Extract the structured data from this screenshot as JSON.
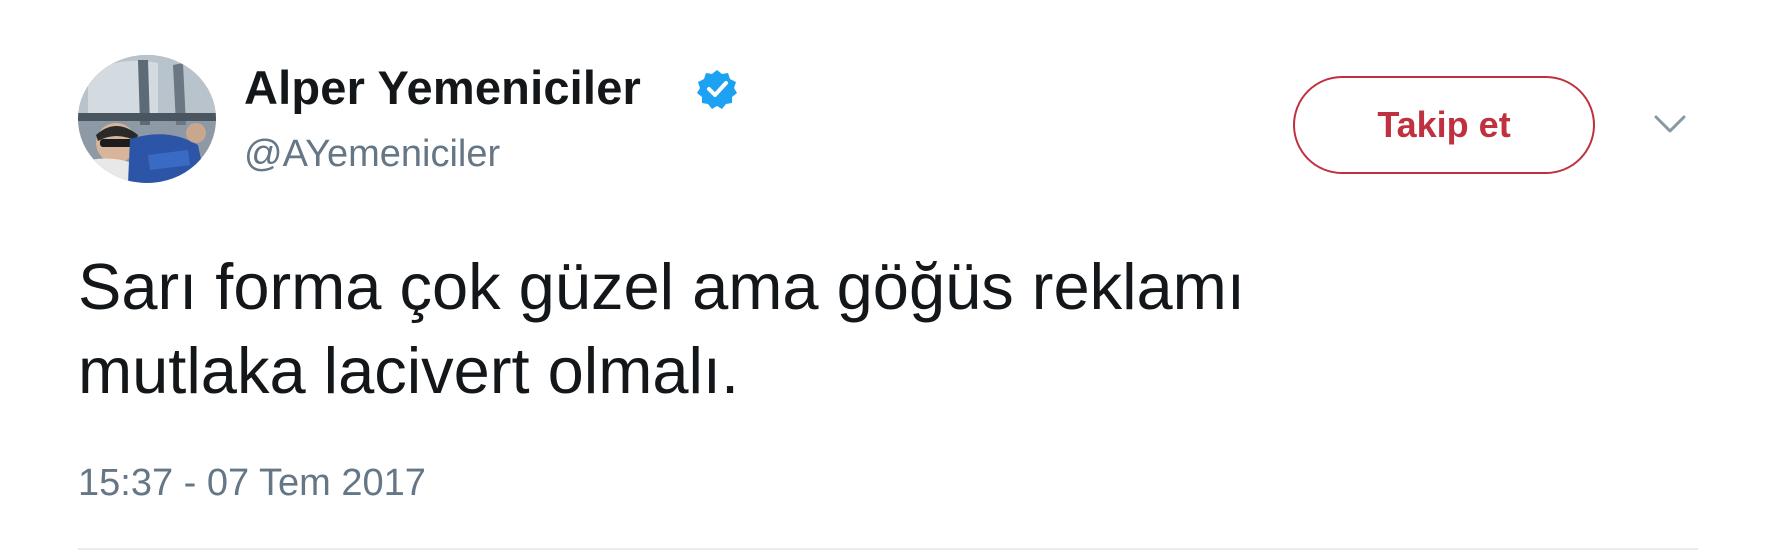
{
  "author": {
    "display_name": "Alper Yemeniciler",
    "handle": "@AYemeniciler",
    "verified": true,
    "verified_color": "#1da1f2"
  },
  "actions": {
    "follow_label": "Takip et",
    "follow_color": "#c0313f",
    "more_icon": "chevron-down-icon"
  },
  "tweet": {
    "text": "Sarı forma çok güzel ama göğüs reklamı\nmutlaka lacivert olmalı.",
    "timestamp": "15:37 - 07 Tem 2017"
  }
}
